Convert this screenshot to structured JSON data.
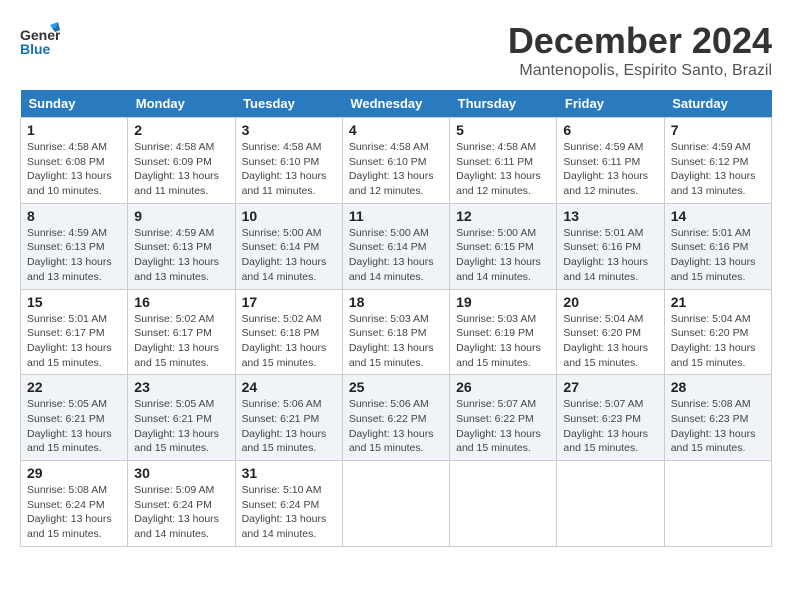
{
  "header": {
    "logo_line1": "General",
    "logo_line2": "Blue",
    "month": "December 2024",
    "location": "Mantenopolis, Espirito Santo, Brazil"
  },
  "weekdays": [
    "Sunday",
    "Monday",
    "Tuesday",
    "Wednesday",
    "Thursday",
    "Friday",
    "Saturday"
  ],
  "weeks": [
    [
      {
        "day": "1",
        "sunrise": "4:58 AM",
        "sunset": "6:08 PM",
        "daylight": "13 hours and 10 minutes."
      },
      {
        "day": "2",
        "sunrise": "4:58 AM",
        "sunset": "6:09 PM",
        "daylight": "13 hours and 11 minutes."
      },
      {
        "day": "3",
        "sunrise": "4:58 AM",
        "sunset": "6:10 PM",
        "daylight": "13 hours and 11 minutes."
      },
      {
        "day": "4",
        "sunrise": "4:58 AM",
        "sunset": "6:10 PM",
        "daylight": "13 hours and 12 minutes."
      },
      {
        "day": "5",
        "sunrise": "4:58 AM",
        "sunset": "6:11 PM",
        "daylight": "13 hours and 12 minutes."
      },
      {
        "day": "6",
        "sunrise": "4:59 AM",
        "sunset": "6:11 PM",
        "daylight": "13 hours and 12 minutes."
      },
      {
        "day": "7",
        "sunrise": "4:59 AM",
        "sunset": "6:12 PM",
        "daylight": "13 hours and 13 minutes."
      }
    ],
    [
      {
        "day": "8",
        "sunrise": "4:59 AM",
        "sunset": "6:13 PM",
        "daylight": "13 hours and 13 minutes."
      },
      {
        "day": "9",
        "sunrise": "4:59 AM",
        "sunset": "6:13 PM",
        "daylight": "13 hours and 13 minutes."
      },
      {
        "day": "10",
        "sunrise": "5:00 AM",
        "sunset": "6:14 PM",
        "daylight": "13 hours and 14 minutes."
      },
      {
        "day": "11",
        "sunrise": "5:00 AM",
        "sunset": "6:14 PM",
        "daylight": "13 hours and 14 minutes."
      },
      {
        "day": "12",
        "sunrise": "5:00 AM",
        "sunset": "6:15 PM",
        "daylight": "13 hours and 14 minutes."
      },
      {
        "day": "13",
        "sunrise": "5:01 AM",
        "sunset": "6:16 PM",
        "daylight": "13 hours and 14 minutes."
      },
      {
        "day": "14",
        "sunrise": "5:01 AM",
        "sunset": "6:16 PM",
        "daylight": "13 hours and 15 minutes."
      }
    ],
    [
      {
        "day": "15",
        "sunrise": "5:01 AM",
        "sunset": "6:17 PM",
        "daylight": "13 hours and 15 minutes."
      },
      {
        "day": "16",
        "sunrise": "5:02 AM",
        "sunset": "6:17 PM",
        "daylight": "13 hours and 15 minutes."
      },
      {
        "day": "17",
        "sunrise": "5:02 AM",
        "sunset": "6:18 PM",
        "daylight": "13 hours and 15 minutes."
      },
      {
        "day": "18",
        "sunrise": "5:03 AM",
        "sunset": "6:18 PM",
        "daylight": "13 hours and 15 minutes."
      },
      {
        "day": "19",
        "sunrise": "5:03 AM",
        "sunset": "6:19 PM",
        "daylight": "13 hours and 15 minutes."
      },
      {
        "day": "20",
        "sunrise": "5:04 AM",
        "sunset": "6:20 PM",
        "daylight": "13 hours and 15 minutes."
      },
      {
        "day": "21",
        "sunrise": "5:04 AM",
        "sunset": "6:20 PM",
        "daylight": "13 hours and 15 minutes."
      }
    ],
    [
      {
        "day": "22",
        "sunrise": "5:05 AM",
        "sunset": "6:21 PM",
        "daylight": "13 hours and 15 minutes."
      },
      {
        "day": "23",
        "sunrise": "5:05 AM",
        "sunset": "6:21 PM",
        "daylight": "13 hours and 15 minutes."
      },
      {
        "day": "24",
        "sunrise": "5:06 AM",
        "sunset": "6:21 PM",
        "daylight": "13 hours and 15 minutes."
      },
      {
        "day": "25",
        "sunrise": "5:06 AM",
        "sunset": "6:22 PM",
        "daylight": "13 hours and 15 minutes."
      },
      {
        "day": "26",
        "sunrise": "5:07 AM",
        "sunset": "6:22 PM",
        "daylight": "13 hours and 15 minutes."
      },
      {
        "day": "27",
        "sunrise": "5:07 AM",
        "sunset": "6:23 PM",
        "daylight": "13 hours and 15 minutes."
      },
      {
        "day": "28",
        "sunrise": "5:08 AM",
        "sunset": "6:23 PM",
        "daylight": "13 hours and 15 minutes."
      }
    ],
    [
      {
        "day": "29",
        "sunrise": "5:08 AM",
        "sunset": "6:24 PM",
        "daylight": "13 hours and 15 minutes."
      },
      {
        "day": "30",
        "sunrise": "5:09 AM",
        "sunset": "6:24 PM",
        "daylight": "13 hours and 14 minutes."
      },
      {
        "day": "31",
        "sunrise": "5:10 AM",
        "sunset": "6:24 PM",
        "daylight": "13 hours and 14 minutes."
      },
      null,
      null,
      null,
      null
    ]
  ]
}
